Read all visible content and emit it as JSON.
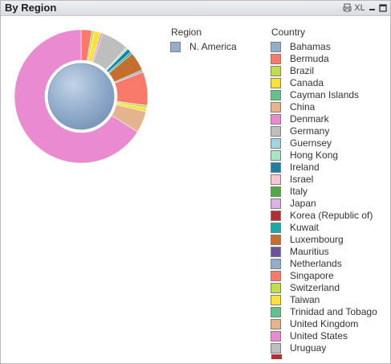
{
  "window": {
    "title": "By Region",
    "buttons": [
      "XL"
    ]
  },
  "chart_data": {
    "type": "pie",
    "subtype": "nested-donut",
    "legends": [
      {
        "title": "Region",
        "entries": [
          {
            "name": "N. America",
            "color": "#93aecd"
          }
        ]
      },
      {
        "title": "Country",
        "entries": [
          {
            "name": "Bahamas",
            "color": "#93aecd"
          },
          {
            "name": "Bermuda",
            "color": "#f97a6b"
          },
          {
            "name": "Brazil",
            "color": "#c1dc4f"
          },
          {
            "name": "Canada",
            "color": "#fbe23a"
          },
          {
            "name": "Cayman Islands",
            "color": "#63c28b"
          },
          {
            "name": "China",
            "color": "#e6b38f"
          },
          {
            "name": "Denmark",
            "color": "#ea8bd1"
          },
          {
            "name": "Germany",
            "color": "#bebebe"
          },
          {
            "name": "Guernsey",
            "color": "#a3d5e0"
          },
          {
            "name": "Hong Kong",
            "color": "#a9e5c3"
          },
          {
            "name": "Ireland",
            "color": "#1d7e9e"
          },
          {
            "name": "Israel",
            "color": "#f7c8d2"
          },
          {
            "name": "Italy",
            "color": "#51a846"
          },
          {
            "name": "Japan",
            "color": "#d8b3e4"
          },
          {
            "name": "Korea (Republic of)",
            "color": "#b23034"
          },
          {
            "name": "Kuwait",
            "color": "#1aa9a4"
          },
          {
            "name": "Luxembourg",
            "color": "#c46f2e"
          },
          {
            "name": "Mauritius",
            "color": "#6b549c"
          },
          {
            "name": "Netherlands",
            "color": "#93aecd"
          },
          {
            "name": "Singapore",
            "color": "#f97a6b"
          },
          {
            "name": "Switzerland",
            "color": "#c1dc4f"
          },
          {
            "name": "Taiwan",
            "color": "#fbe23a"
          },
          {
            "name": "Trinidad and Tobago",
            "color": "#63c28b"
          },
          {
            "name": "United Kingdom",
            "color": "#e6b38f"
          },
          {
            "name": "United States",
            "color": "#ea8bd1"
          },
          {
            "name": "Uruguay",
            "color": "#bebebe"
          }
        ]
      }
    ],
    "inner": [
      {
        "name": "N. America",
        "value": 100,
        "color": "#93aecd"
      }
    ],
    "outer": [
      {
        "name": "Bermuda",
        "value": 2.6,
        "color": "#f97a6b"
      },
      {
        "name": "Brazil",
        "value": 0.6,
        "color": "#c1dc4f"
      },
      {
        "name": "Canada",
        "value": 1.6,
        "color": "#fbe23a"
      },
      {
        "name": "Denmark",
        "value": 0.5,
        "color": "#ea8bd1"
      },
      {
        "name": "Germany",
        "value": 6.6,
        "color": "#bebebe"
      },
      {
        "name": "Hong Kong",
        "value": 0.5,
        "color": "#a9e5c3"
      },
      {
        "name": "Ireland",
        "value": 1.0,
        "color": "#1d7e9e"
      },
      {
        "name": "Kuwait",
        "value": 0.5,
        "color": "#1aa9a4"
      },
      {
        "name": "Luxembourg",
        "value": 4.6,
        "color": "#c46f2e"
      },
      {
        "name": "Netherlands",
        "value": 0.5,
        "color": "#93aecd"
      },
      {
        "name": "Singapore",
        "value": 8.2,
        "color": "#f97a6b"
      },
      {
        "name": "Switzerland",
        "value": 0.6,
        "color": "#c1dc4f"
      },
      {
        "name": "Taiwan",
        "value": 0.9,
        "color": "#fbe23a"
      },
      {
        "name": "United Kingdom",
        "value": 5.2,
        "color": "#e6b38f"
      },
      {
        "name": "United States",
        "value": 66.1,
        "color": "#ea8bd1"
      }
    ]
  }
}
